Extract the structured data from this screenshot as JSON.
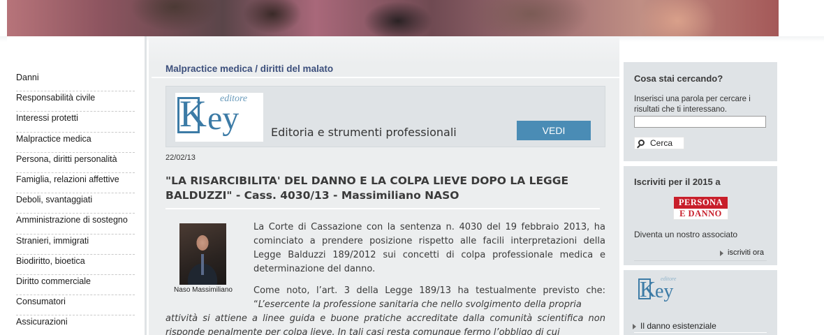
{
  "nav": {
    "items": [
      "Danni",
      "Responsabilità civile",
      "Interessi protetti",
      "Malpractice medica",
      "Persona, diritti personalità",
      "Famiglia, relazioni affettive",
      "Deboli, svantaggiati",
      "Amministrazione di sostegno",
      "Stranieri, immigrati",
      "Biodiritto, bioetica",
      "Diritto commerciale",
      "Consumatori",
      "Assicurazioni"
    ]
  },
  "main": {
    "section_title": "Malpractice medica / diritti del malato",
    "ad": {
      "logo_editore": "editore",
      "logo_k": "K",
      "logo_ey": "ey",
      "tagline": "Editoria e strumenti professionali",
      "button_label": "VEDI"
    },
    "date": "22/02/13",
    "article_title": "\"LA RISARCIBILITA' DEL DANNO E LA COLPA LIEVE DOPO LA LEGGE BALDUZZI\" - Cass. 4030/13 - Massimiliano NASO",
    "author_caption": "Naso Massimiliano",
    "paragraph1": "La Corte di Cassazione con la sentenza n. 4030 del 19 febbraio 2013, ha cominciato a prendere posizione rispetto alle facili interpretazioni della Legge Balduzzi 189/2012 sui concetti di colpa professionale medica e determinazione del danno.",
    "paragraph2_intro": "Come noto, l’art. 3 della Legge 189/13 ha testualmente previsto che: “",
    "paragraph2_quote_start": "L’esercente la professione sanitaria che nello svolgimento della propria",
    "paragraph2_quote": "attività si attiene a linee guida e buone pratiche accreditate dalla comunità scientifica non risponde penalmente per colpa lieve. In tali casi resta comunque fermo l’obbligo di cui"
  },
  "sidebar": {
    "search": {
      "title": "Cosa stai cercando?",
      "description": "Inserisci una parola per cercare i risultati che ti interessano.",
      "input_value": "",
      "button_label": "Cerca"
    },
    "join": {
      "title": "Iscriviti per il 2015 a",
      "logo_top": "PERSONA",
      "logo_bottom": "E DANNO",
      "description": "Diventa un nostro associato",
      "link_label": "iscriviti ora"
    },
    "key": {
      "logo_editore": "editore",
      "logo_k": "K",
      "logo_ey": "ey",
      "link_label": "Il danno esistenziale"
    }
  }
}
